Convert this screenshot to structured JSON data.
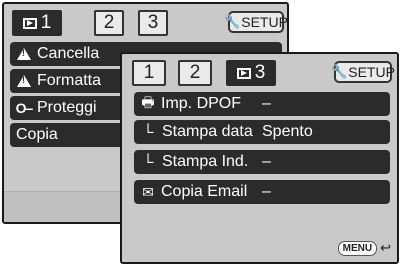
{
  "back": {
    "tabs": [
      "1",
      "2",
      "3"
    ],
    "setup_label": "SETUP",
    "items": [
      {
        "label": "Cancella",
        "icon": "warning-icon"
      },
      {
        "label": "Formatta",
        "icon": "warning-icon"
      },
      {
        "label": "Proteggi",
        "icon": "key-icon"
      },
      {
        "label": "Copia",
        "icon": ""
      }
    ]
  },
  "front": {
    "tabs": [
      "1",
      "2",
      "3"
    ],
    "setup_label": "SETUP",
    "items": [
      {
        "label": "Imp. DPOF",
        "value": "–",
        "icon": "print-icon"
      },
      {
        "label": "Stampa data",
        "value": "Spento",
        "icon": "sub-item-icon"
      },
      {
        "label": "Stampa Ind.",
        "value": "–",
        "icon": "sub-item-icon"
      },
      {
        "label": "Copia Email",
        "value": "–",
        "icon": "email-icon"
      }
    ],
    "menu_label": "MENU"
  },
  "colors": {
    "panel": "#c9c9c9",
    "row": "#2b2b2b",
    "active_tab": "#2b2b2b"
  }
}
